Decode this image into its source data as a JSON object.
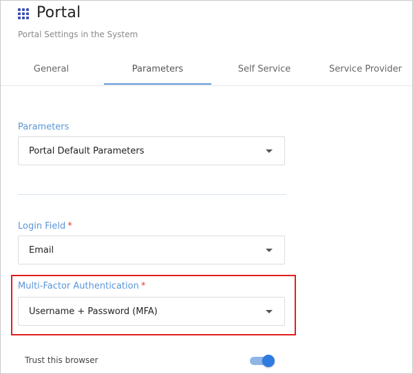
{
  "header": {
    "title": "Portal",
    "subtitle": "Portal Settings in the System",
    "icon": "apps-grid-icon",
    "accent_color": "#3f51b5"
  },
  "tabs": [
    {
      "label": "General",
      "active": false
    },
    {
      "label": "Parameters",
      "active": true
    },
    {
      "label": "Self Service",
      "active": false
    },
    {
      "label": "Service Provider",
      "active": false
    }
  ],
  "form": {
    "parameters": {
      "label": "Parameters",
      "value": "Portal Default Parameters",
      "required": false
    },
    "login_field": {
      "label": "Login Field",
      "required_mark": "*",
      "value": "Email"
    },
    "mfa": {
      "label": "Multi-Factor Authentication",
      "required_mark": "*",
      "value": "Username + Password (MFA)",
      "highlighted": true
    },
    "trust_browser": {
      "label": "Trust this browser",
      "enabled": true
    }
  },
  "colors": {
    "label_blue": "#5b95d6",
    "required_red": "#e53935",
    "highlight_red": "#e21b1b",
    "toggle_on": "#2f7be0"
  }
}
